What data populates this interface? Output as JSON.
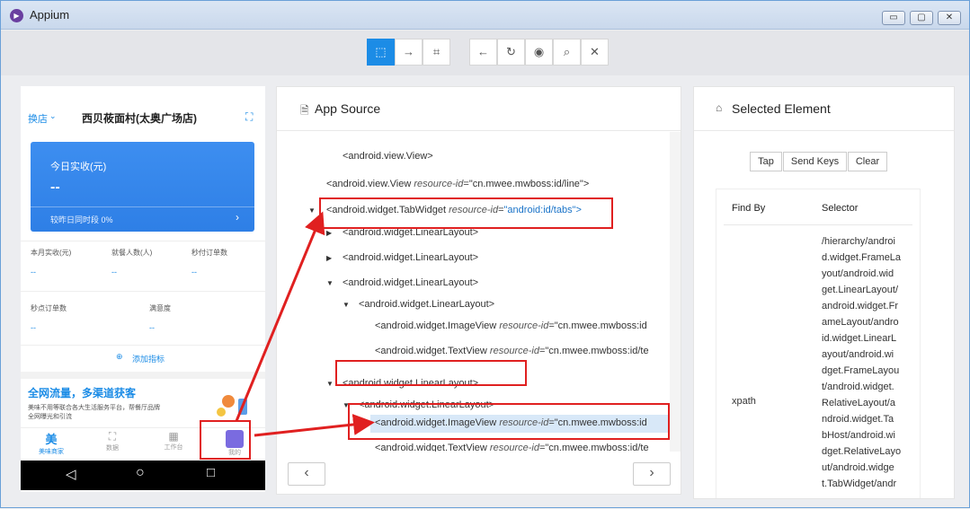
{
  "window": {
    "title": "Appium",
    "btn_min": "▭",
    "btn_max": "▢",
    "btn_close": "✕"
  },
  "toolbar": {
    "select": "⬚",
    "swipe": "→",
    "tap_coords": "⌗",
    "back": "←",
    "refresh": "↻",
    "show": "◉",
    "search": "⌕",
    "quit": "✕"
  },
  "phone": {
    "store_switch": "换店",
    "store_name": "西贝莜面村(太奥广场店)",
    "card_title": "今日实收(元)",
    "card_value": "--",
    "card_compare": "较昨日同时段 0%",
    "metrics": [
      {
        "label": "本月实收(元)",
        "value": "--"
      },
      {
        "label": "就餐人数(人)",
        "value": "--"
      },
      {
        "label": "秒付订单数",
        "value": "--"
      },
      {
        "label": "秒点订单数",
        "value": "--"
      },
      {
        "label": "满意度",
        "value": "--"
      }
    ],
    "add_metric": "添加指标",
    "banner_title": "全网流量，多渠道获客",
    "banner_text1": "美味不用等联合各大生活服务平台，帮餐厅品牌",
    "banner_text2": "全网曝光和引流",
    "tabs": [
      {
        "label": "美味商家",
        "icon": "美"
      },
      {
        "label": "数据",
        "icon": "📈"
      },
      {
        "label": "工作台",
        "icon": "▦"
      },
      {
        "label": "我的",
        "icon": "👤"
      }
    ],
    "nav": {
      "back": "◁",
      "home": "○",
      "recent": "□"
    }
  },
  "source": {
    "title": "App Source",
    "lines": [
      {
        "tag": "<android.view.View>",
        "attr": "",
        "val": ""
      },
      {
        "tag": "<android.view.View",
        "attr": "resource-id",
        "val": "\"cn.mwee.mwboss:id/line\">"
      },
      {
        "tag": "<android.widget.TabWidget",
        "attr": "resource-id",
        "val": "\"android:id/tabs\">"
      },
      {
        "tag": "<android.widget.LinearLayout>",
        "attr": "",
        "val": ""
      },
      {
        "tag": "<android.widget.LinearLayout>",
        "attr": "",
        "val": ""
      },
      {
        "tag": "<android.widget.LinearLayout>",
        "attr": "",
        "val": ""
      },
      {
        "tag": "<android.widget.LinearLayout>",
        "attr": "",
        "val": ""
      },
      {
        "tag": "<android.widget.ImageView",
        "attr": "resource-id",
        "val": "\"cn.mwee.mwboss:id"
      },
      {
        "tag": "<android.widget.TextView",
        "attr": "resource-id",
        "val": "\"cn.mwee.mwboss:id/te"
      },
      {
        "tag": "<android.widget.LinearLayout>",
        "attr": "",
        "val": ""
      },
      {
        "tag": "<android.widget.LinearLayout>",
        "attr": "",
        "val": ""
      },
      {
        "tag": "<android.widget.ImageView",
        "attr": "resource-id",
        "val": "\"cn.mwee.mwboss:id"
      },
      {
        "tag": "<android.widget.TextView",
        "attr": "resource-id",
        "val": "\"cn.mwee.mwboss:id/te"
      }
    ],
    "prev": "‹",
    "next": "›"
  },
  "selected": {
    "title": "Selected Element",
    "tap": "Tap",
    "send_keys": "Send Keys",
    "clear": "Clear",
    "col_find_by": "Find By",
    "col_selector": "Selector",
    "find_by": "xpath",
    "selector_lines": [
      "/hierarchy/androi",
      "d.widget.FrameLa",
      "yout/android.wid",
      "get.LinearLayout/",
      "android.widget.Fr",
      "ameLayout/andro",
      "id.widget.LinearL",
      "ayout/android.wi",
      "dget.FrameLayou",
      "t/android.widget.",
      "RelativeLayout/a",
      "ndroid.widget.Ta",
      "bHost/android.wi",
      "dget.RelativeLayo",
      "ut/android.widge",
      "t.TabWidget/andr"
    ]
  },
  "colors": {
    "accent": "#1c8ce6",
    "annotation": "#e02020"
  }
}
